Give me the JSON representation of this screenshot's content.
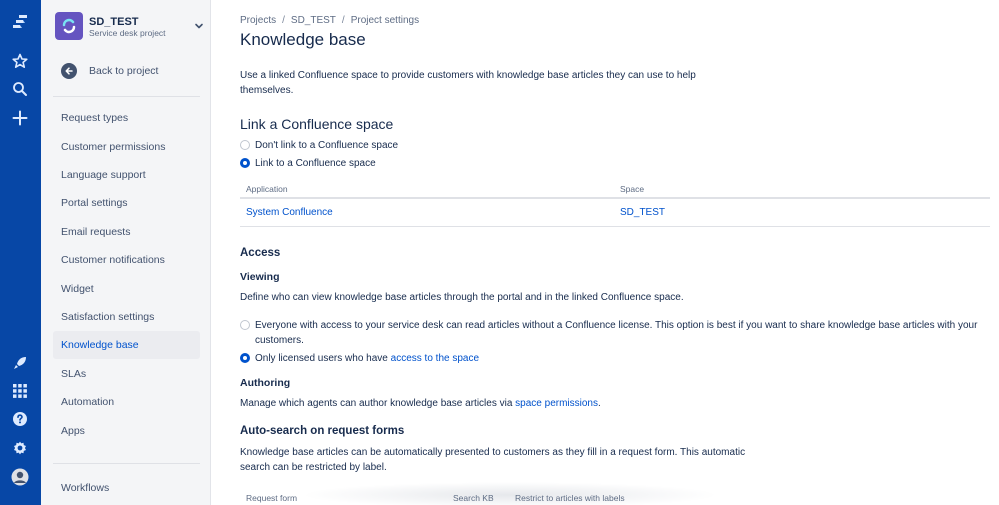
{
  "project": {
    "name": "SD_TEST",
    "type": "Service desk project",
    "back_label": "Back to project"
  },
  "sidebar": {
    "items": [
      {
        "label": "Request types"
      },
      {
        "label": "Customer permissions"
      },
      {
        "label": "Language support"
      },
      {
        "label": "Portal settings"
      },
      {
        "label": "Email requests"
      },
      {
        "label": "Customer notifications"
      },
      {
        "label": "Widget"
      },
      {
        "label": "Satisfaction settings"
      },
      {
        "label": "Knowledge base",
        "active": true
      },
      {
        "label": "SLAs"
      },
      {
        "label": "Automation"
      },
      {
        "label": "Apps"
      }
    ],
    "workflows_label": "Workflows"
  },
  "breadcrumb": {
    "items": [
      "Projects",
      "SD_TEST",
      "Project settings"
    ],
    "separator": "/"
  },
  "page": {
    "title": "Knowledge base",
    "intro": "Use a linked Confluence space to provide customers with knowledge base articles they can use to help themselves."
  },
  "link_section": {
    "heading": "Link a Confluence space",
    "option_none": "Don't link to a Confluence space",
    "option_link": "Link to a Confluence space",
    "selected": "option_link",
    "table": {
      "col_application": "Application",
      "col_space": "Space",
      "application": "System Confluence",
      "space": "SD_TEST"
    }
  },
  "access": {
    "heading": "Access",
    "viewing_heading": "Viewing",
    "viewing_desc": "Define who can view knowledge base articles through the portal and in the linked Confluence space.",
    "option_everyone_line1": "Everyone with access to your service desk can read articles without a Confluence license. This option is best if you want to share knowledge base articles with your",
    "option_everyone_line2": "customers.",
    "option_licensed_prefix": "Only licensed users who have",
    "option_licensed_link": "access to the space",
    "selected": "option_licensed",
    "authoring_heading": "Authoring",
    "authoring_prefix": "Manage which agents can author knowledge base articles via",
    "authoring_link": "space permissions",
    "authoring_suffix": "."
  },
  "autosearch": {
    "heading": "Auto-search on request forms",
    "desc_line1": "Knowledge base articles can be automatically presented to customers as they fill in a request form. This automatic",
    "desc_line2": "search can be restricted by label.",
    "col_request_form": "Request form",
    "col_search_kb": "Search KB",
    "col_restrict": "Restrict to articles with labels"
  },
  "colors": {
    "global_nav": "#0747a6",
    "link": "#0052cc",
    "project_avatar": "#6554c0"
  },
  "icons": [
    "jira-logo-icon",
    "star-icon",
    "search-icon",
    "plus-icon",
    "rocket-icon",
    "app-switcher-icon",
    "help-icon",
    "settings-icon",
    "user-avatar-icon",
    "chevron-down-icon",
    "arrow-left-icon"
  ]
}
